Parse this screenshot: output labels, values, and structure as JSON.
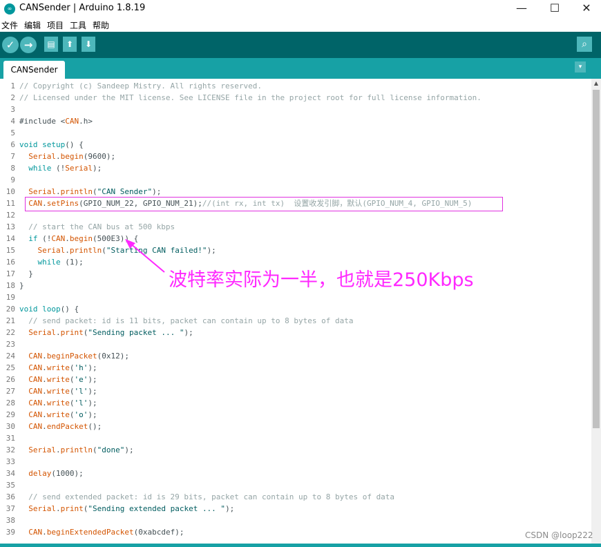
{
  "window": {
    "title": "CANSender | Arduino 1.8.19",
    "logo": "∞",
    "minimize": "—",
    "maximize": "☐",
    "close": "✕"
  },
  "menu": [
    "文件",
    "编辑",
    "项目",
    "工具",
    "帮助"
  ],
  "toolbar": {
    "verify_icon": "✓",
    "upload_icon": "→",
    "new_icon": "▤",
    "open_icon": "⬆",
    "save_icon": "⬇",
    "monitor_icon": "⌕"
  },
  "tabs": {
    "active": "CANSender",
    "menu_icon": "▾"
  },
  "code_lines": [
    {
      "n": "1",
      "html": "<span class=\"cm\">// Copyright (c) Sandeep Mistry. All rights reserved.</span>"
    },
    {
      "n": "2",
      "html": "<span class=\"cm\">// Licensed under the MIT license. See LICENSE file in the project root for full license information.</span>"
    },
    {
      "n": "3",
      "html": ""
    },
    {
      "n": "4",
      "html": "#include &lt;<span class=\"kw-o\">CAN</span>.h&gt;"
    },
    {
      "n": "5",
      "html": ""
    },
    {
      "n": "6",
      "html": "<span class=\"kw-t\">void</span> <span class=\"kw-t\">setup</span>() {"
    },
    {
      "n": "7",
      "html": "  <span class=\"kw-o\">Serial</span>.<span class=\"kw-o\">begin</span>(9600);"
    },
    {
      "n": "8",
      "html": "  <span class=\"kw-t\">while</span> (!<span class=\"kw-o\">Serial</span>);"
    },
    {
      "n": "9",
      "html": ""
    },
    {
      "n": "10",
      "html": "  <span class=\"kw-o\">Serial</span>.<span class=\"kw-o\">println</span>(<span class=\"str\">\"CAN Sender\"</span>);"
    },
    {
      "n": "11",
      "html": "  <span class=\"kw-o\">CAN</span>.<span class=\"kw-o\">setPins</span>(GPIO_NUM_22, GPIO_NUM_21);<span class=\"cm\">//(int rx, int tx)  设置收发引脚，默认(GPIO_NUM_4, GPIO_NUM_5)</span>"
    },
    {
      "n": "12",
      "html": ""
    },
    {
      "n": "13",
      "html": "  <span class=\"cm\">// start the CAN bus at 500 kbps</span>"
    },
    {
      "n": "14",
      "html": "  <span class=\"kw-t\">if</span> (!<span class=\"kw-o\">CAN</span>.<span class=\"kw-o\">begin</span>(500E3)) {"
    },
    {
      "n": "15",
      "html": "    <span class=\"kw-o\">Serial</span>.<span class=\"kw-o\">println</span>(<span class=\"str\">\"Starting CAN failed!\"</span>);"
    },
    {
      "n": "16",
      "html": "    <span class=\"kw-t\">while</span> (1);"
    },
    {
      "n": "17",
      "html": "  }"
    },
    {
      "n": "18",
      "html": "}"
    },
    {
      "n": "19",
      "html": ""
    },
    {
      "n": "20",
      "html": "<span class=\"kw-t\">void</span> <span class=\"kw-t\">loop</span>() {"
    },
    {
      "n": "21",
      "html": "  <span class=\"cm\">// send packet: id is 11 bits, packet can contain up to 8 bytes of data</span>"
    },
    {
      "n": "22",
      "html": "  <span class=\"kw-o\">Serial</span>.<span class=\"kw-o\">print</span>(<span class=\"str\">\"Sending packet ... \"</span>);"
    },
    {
      "n": "23",
      "html": ""
    },
    {
      "n": "24",
      "html": "  <span class=\"kw-o\">CAN</span>.<span class=\"kw-o\">beginPacket</span>(0x12);"
    },
    {
      "n": "25",
      "html": "  <span class=\"kw-o\">CAN</span>.<span class=\"kw-o\">write</span>(<span class=\"str\">'h'</span>);"
    },
    {
      "n": "26",
      "html": "  <span class=\"kw-o\">CAN</span>.<span class=\"kw-o\">write</span>(<span class=\"str\">'e'</span>);"
    },
    {
      "n": "27",
      "html": "  <span class=\"kw-o\">CAN</span>.<span class=\"kw-o\">write</span>(<span class=\"str\">'l'</span>);"
    },
    {
      "n": "28",
      "html": "  <span class=\"kw-o\">CAN</span>.<span class=\"kw-o\">write</span>(<span class=\"str\">'l'</span>);"
    },
    {
      "n": "29",
      "html": "  <span class=\"kw-o\">CAN</span>.<span class=\"kw-o\">write</span>(<span class=\"str\">'o'</span>);"
    },
    {
      "n": "30",
      "html": "  <span class=\"kw-o\">CAN</span>.<span class=\"kw-o\">endPacket</span>();"
    },
    {
      "n": "31",
      "html": ""
    },
    {
      "n": "32",
      "html": "  <span class=\"kw-o\">Serial</span>.<span class=\"kw-o\">println</span>(<span class=\"str\">\"done\"</span>);"
    },
    {
      "n": "33",
      "html": ""
    },
    {
      "n": "34",
      "html": "  <span class=\"kw-o\">delay</span>(1000);"
    },
    {
      "n": "35",
      "html": ""
    },
    {
      "n": "36",
      "html": "  <span class=\"cm\">// send extended packet: id is 29 bits, packet can contain up to 8 bytes of data</span>"
    },
    {
      "n": "37",
      "html": "  <span class=\"kw-o\">Serial</span>.<span class=\"kw-o\">print</span>(<span class=\"str\">\"Sending extended packet ... \"</span>);"
    },
    {
      "n": "38",
      "html": ""
    },
    {
      "n": "39",
      "html": "  <span class=\"kw-o\">CAN</span>.<span class=\"kw-o\">beginExtendedPacket</span>(0xabcdef);"
    }
  ],
  "annotation": "波特率实际为一半，也就是250Kbps",
  "watermark": "CSDN @loop222",
  "colors": {
    "teal_dark": "#006468",
    "teal": "#17a1a5",
    "annotation": "#ff28ff",
    "keyword_orange": "#d35400",
    "keyword_teal": "#00979c"
  }
}
